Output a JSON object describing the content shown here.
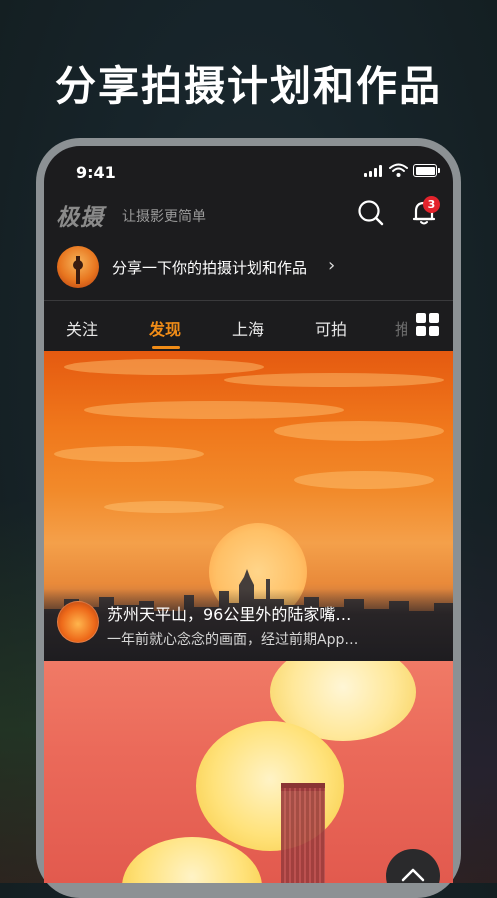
{
  "headline": "分享拍摄计划和作品",
  "status_bar": {
    "time": "9:41"
  },
  "app_bar": {
    "logo": "极摄",
    "slogan": "让摄影更简单",
    "notification_count": "3"
  },
  "share_prompt": {
    "text": "分享一下你的拍摄计划和作品",
    "arrow": "›"
  },
  "tabs": [
    {
      "label": "关注",
      "active": false
    },
    {
      "label": "发现",
      "active": true
    },
    {
      "label": "上海",
      "active": false
    },
    {
      "label": "可拍",
      "active": false
    },
    {
      "label": "推",
      "active": false
    }
  ],
  "feed": [
    {
      "title": "苏州天平山，96公里外的陆家嘴…",
      "subtitle": "一年前就心念念的画面，经过前期App…"
    }
  ],
  "colors": {
    "accent": "#f08c17",
    "badge": "#e3232c",
    "screen_bg": "#1c1c1e"
  },
  "icons": [
    "search-icon",
    "bell-icon",
    "grid-icon",
    "chevron-up-icon",
    "signal-icon",
    "wifi-icon",
    "battery-icon"
  ]
}
